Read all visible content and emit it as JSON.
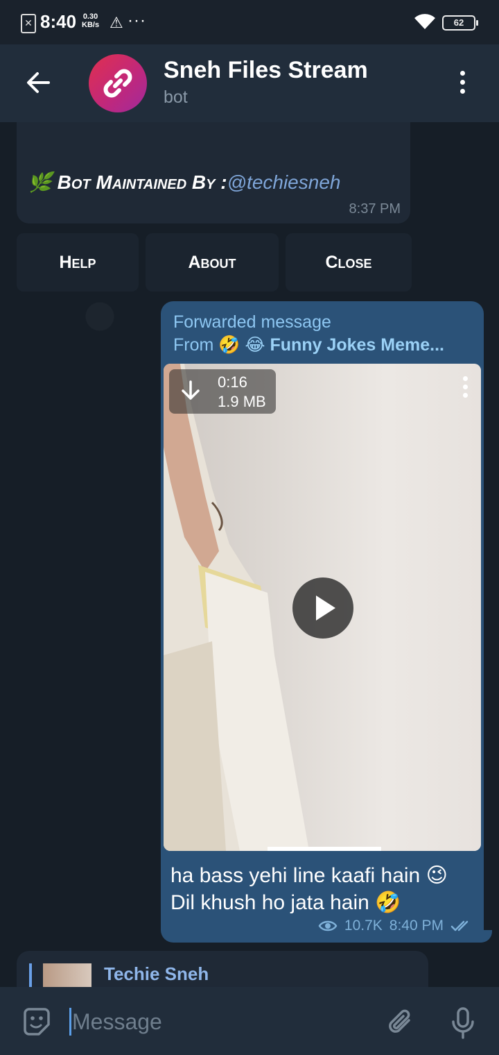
{
  "status_bar": {
    "time": "8:40",
    "speed_value": "0.30",
    "speed_unit": "KB/s",
    "warning": "⚠",
    "dots": "···",
    "battery": "62"
  },
  "header": {
    "title": "Sneh Files Stream",
    "subtitle": "bot"
  },
  "bot_message": {
    "leaf_emoji": "🌿",
    "label": "Bot Maintained By :",
    "handle": "@techiesneh",
    "time": "8:37 PM"
  },
  "inline_buttons": [
    "Help",
    "About",
    "Close"
  ],
  "forwarded": {
    "label": "Forwarded message",
    "from_prefix": "From",
    "from_name": "🤣 😂 Funny Jokes Meme...",
    "video_duration": "0:16",
    "video_size": "1.9 MB",
    "caption_line1": "ha bass yehi line kaafi hain 😉",
    "caption_line2": "Dil khush ho jata hain 🤣",
    "views": "10.7K",
    "time": "8:40 PM"
  },
  "reply_preview": {
    "name": "Techie Sneh"
  },
  "composer": {
    "placeholder": "Message"
  },
  "colors": {
    "header_bg": "#212d3b",
    "outgoing_bubble": "#2b5278",
    "incoming_bubble": "#1f2936",
    "link": "#7fa6d9",
    "accent_blue": "#8ec7f2"
  }
}
